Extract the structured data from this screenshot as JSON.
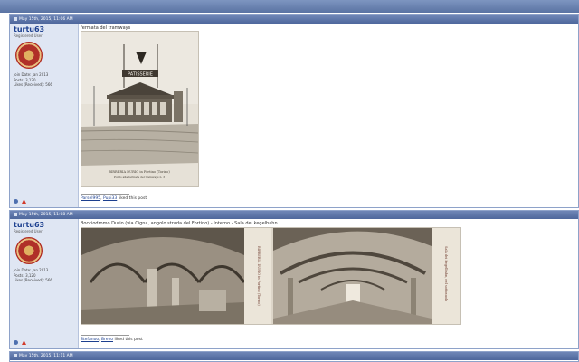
{
  "posts": [
    {
      "date": "May 15th, 2015, 11:06 AM",
      "username": "turtu63",
      "user_title": "Registered User",
      "join_date": "Join Date: Jan 2013",
      "posts": "Posts: 3,120",
      "likes_received": "Likes (Received): 566",
      "title": "fermata del tramways",
      "liker1": "Parsel995",
      "liker2": "Pupi33",
      "liked_text": "liked this post"
    },
    {
      "date": "May 15th, 2015, 11:08 AM",
      "username": "turtu63",
      "user_title": "Registered User",
      "join_date": "Join Date: Jan 2013",
      "posts": "Posts: 3,120",
      "likes_received": "Likes (Received): 566",
      "title": "Bocciodromo Durio (via Cigna, angolo strada del Fortino) - Interno - Sala dei kegelbahn",
      "liker1": "Stefanoo",
      "liker2": "Brevo",
      "liked_text": "liked this post"
    }
  ],
  "footer_post": {
    "date": "May 15th, 2015, 11:11 AM"
  },
  "card1": {
    "sign": "PATISSERIE",
    "caption1": "BIRRERIA DURIO in Fortino (Torino)",
    "caption2": "Punto alla fermata del tramways n. 3"
  },
  "card2": {
    "caption1": "BIRRERIA DURIO in Fortino (Torino)",
    "caption2": "Sala dei Kegelbahn, nel sottosuolo"
  }
}
